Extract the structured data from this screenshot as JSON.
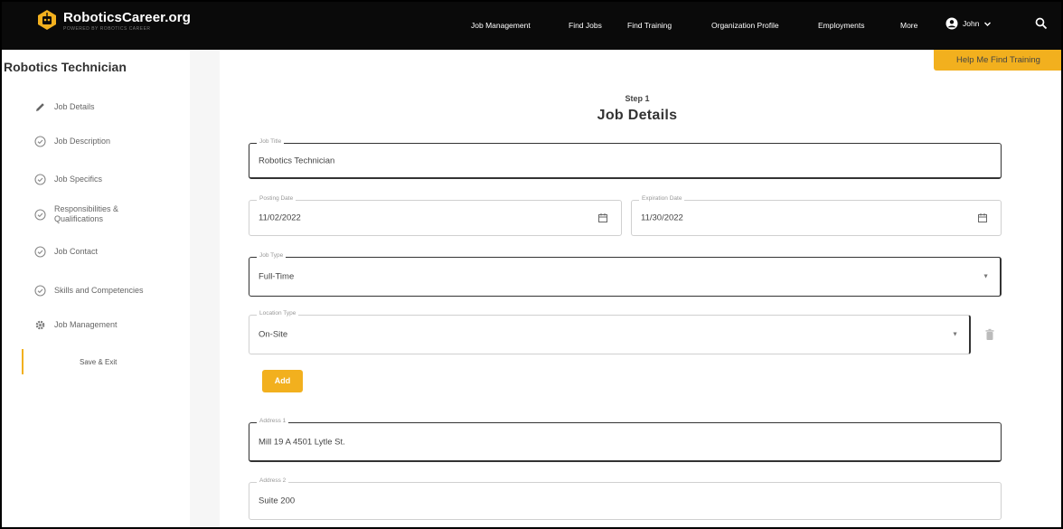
{
  "brand": {
    "name": "RoboticsCareer.org",
    "tagline": "POWERED BY ROBOTICS CAREER",
    "accent": "#f2b01e",
    "topbar_color": "#0a0a0a"
  },
  "nav": {
    "items": [
      "Job Management",
      "Find Jobs",
      "Find Training",
      "Organization Profile",
      "Employments",
      "More"
    ],
    "account_label": "John",
    "account_icon": "user-circle-icon",
    "search_icon": "search-icon"
  },
  "help_tab": "Help Me Find Training",
  "sidebar": {
    "title": "Robotics Technician",
    "items": [
      {
        "label": "Job Details",
        "icon": "pencil-icon"
      },
      {
        "label": "Job Description",
        "icon": "check-circle-icon"
      },
      {
        "label": "Job Specifics",
        "icon": "check-circle-icon"
      },
      {
        "label": "Responsibilities & Qualifications",
        "icon": "check-circle-icon"
      },
      {
        "label": "Job Contact",
        "icon": "check-circle-icon"
      },
      {
        "label": "Skills and Competencies",
        "icon": "check-circle-icon"
      },
      {
        "label": "Job Management",
        "icon": "gear-icon"
      }
    ],
    "save_exit": "Save & Exit"
  },
  "main": {
    "step_label": "Step 1",
    "title": "Job Details",
    "fields": {
      "job_title": {
        "label": "Job Title",
        "value": "Robotics Technician"
      },
      "posting_date": {
        "label": "Posting Date",
        "value": "11/02/2022"
      },
      "expiration_date": {
        "label": "Expiration Date",
        "value": "11/30/2022"
      },
      "job_type": {
        "label": "Job Type",
        "value": "Full-Time"
      },
      "location_type": {
        "label": "Location Type",
        "value": "On-Site"
      },
      "address1": {
        "label": "Address 1",
        "value": "Mill 19 A 4501 Lytle St."
      },
      "address2": {
        "label": "Address 2",
        "value": "Suite 200"
      }
    },
    "add_button": "Add"
  }
}
